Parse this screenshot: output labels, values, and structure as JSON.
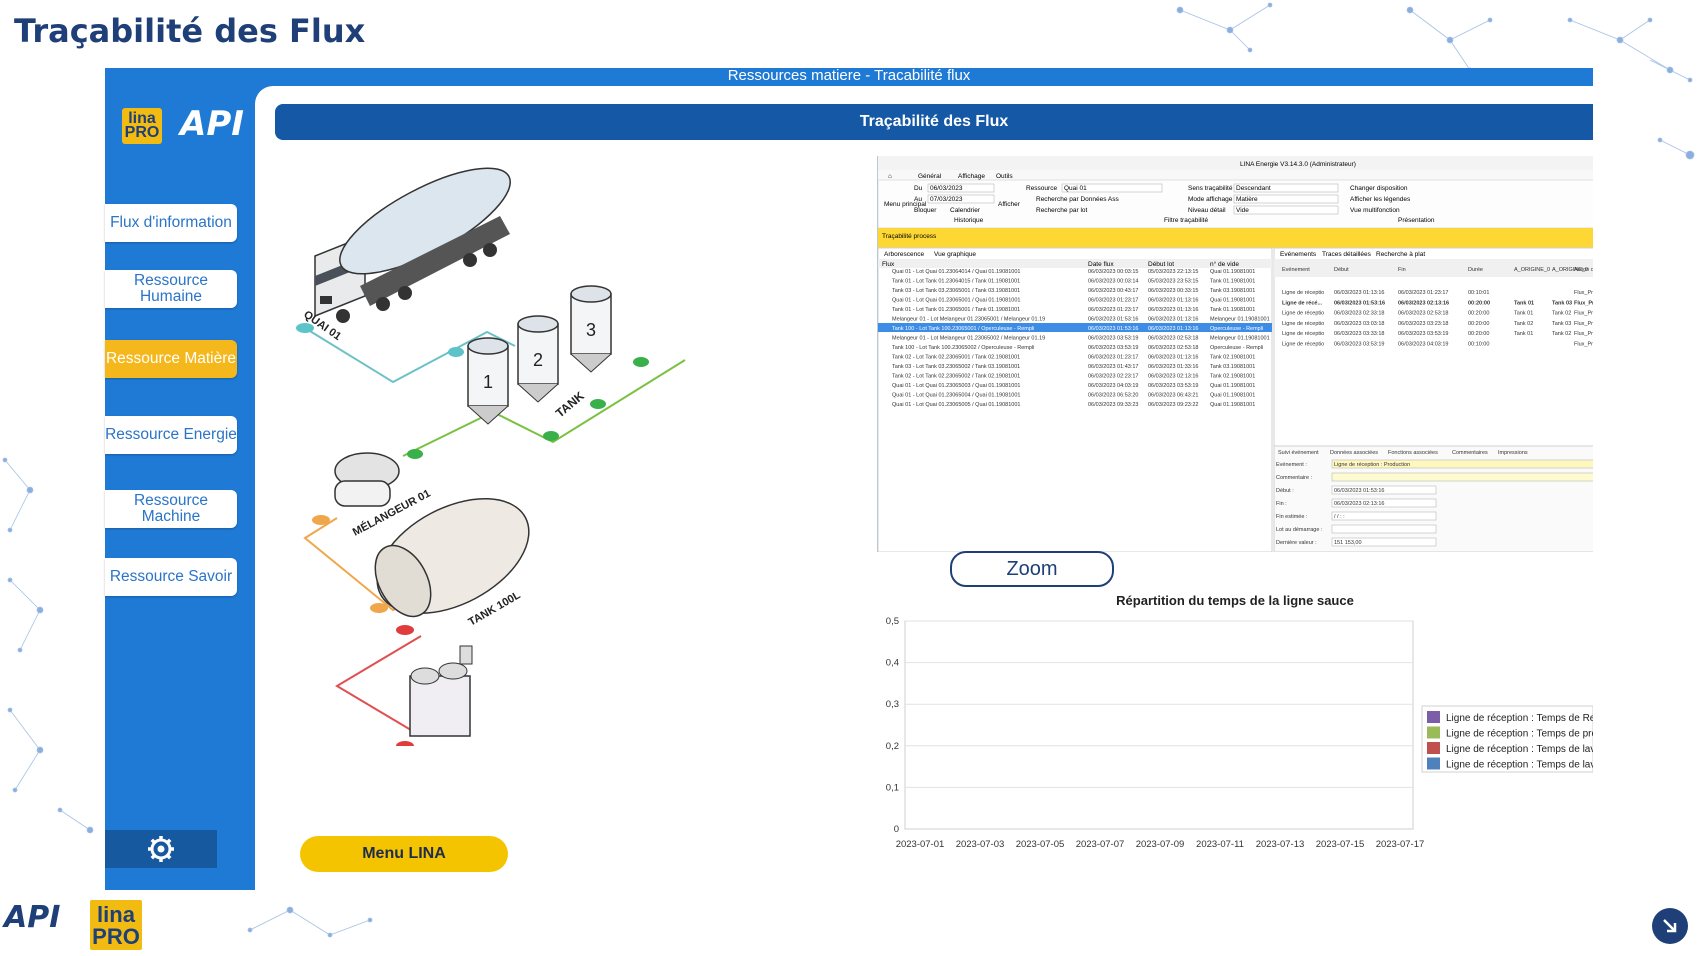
{
  "slide_title": "Traçabilité des Flux",
  "app": {
    "window_title": "Ressources matiere - Tracabilité flux",
    "logo_lina": "lina PRO",
    "logo_api": "API",
    "panel_header": "Traçabilité des Flux",
    "menu_button": "Menu LINA",
    "zoom_button": "Zoom"
  },
  "sidebar": {
    "items": [
      {
        "label": "Flux d'information",
        "active": false
      },
      {
        "label": "Ressource Humaine",
        "active": false
      },
      {
        "label": "Ressource Matière",
        "active": true
      },
      {
        "label": "Ressource Energie",
        "active": false
      },
      {
        "label": "Ressource Machine",
        "active": false
      },
      {
        "label": "Ressource Savoir",
        "active": false
      }
    ],
    "settings_icon": "gear-icon"
  },
  "diagram": {
    "labels": {
      "quai": "QUAI 01",
      "tank": "TANK",
      "tank1": "1",
      "tank2": "2",
      "tank3": "3",
      "melangeur": "MÉLANGEUR 01",
      "tank100": "TANK 100L"
    }
  },
  "embedded_app": {
    "title": "LINA Energie  V3.14.3.0  (Administrateur)",
    "tabs": [
      "Général",
      "Affichage",
      "Outils"
    ],
    "ribbon": {
      "du_label": "Du",
      "du_value": "06/03/2023",
      "au_label": "Au",
      "au_value": "07/03/2023",
      "bloquer": "Bloquer",
      "calendrier": "Calendrier",
      "historique": "Historique",
      "afficher": "Afficher",
      "ressource_label": "Ressource",
      "ressource_value": "Quai 01",
      "recherche_donnees": "Recherche par Données Ass",
      "recherche_lot": "Recherche par lot",
      "sens_label": "Sens traçabilité",
      "sens_value": "Descendant",
      "mode_label": "Mode affichage",
      "mode_value": "Matière",
      "niveau_label": "Niveau détail",
      "niveau_value": "Vide",
      "filtre": "Filtre traçabilité",
      "changer_disposition": "Changer disposition",
      "afficher_legendes": "Afficher les légendes",
      "vue_multifonction": "Vue multifonction",
      "presentation": "Présentation",
      "menu_principal": "Menu principal"
    },
    "section_title": "Traçabilité process",
    "left_tabs": [
      "Arborescence",
      "Vue graphique"
    ],
    "tree_headers": [
      "Flux",
      "Date flux",
      "Début lot",
      "n° de vide"
    ],
    "tree_rows": [
      [
        "Quai 01 - Lot Quai 01.23064014 / Quai 01.19081001",
        "06/03/2023 00:03:15",
        "05/03/2023 22:13:15",
        "Quai 01.19081001"
      ],
      [
        "Tank 01 - Lot Tank 01.23064015 / Tank 01.19081001",
        "06/03/2023 00:03:14",
        "05/03/2023 23:53:15",
        "Tank 01.19081001"
      ],
      [
        "Tank 03 - Lot Tank 03.23065001 / Tank 03.19081001",
        "06/03/2023 00:43:17",
        "06/03/2023 00:33:15",
        "Tank 03.19081001"
      ],
      [
        "Quai 01 - Lot Quai 01.23065001 / Quai 01.19081001",
        "06/03/2023 01:23:17",
        "06/03/2023 01:13:16",
        "Quai 01.19081001"
      ],
      [
        "Tank 01 - Lot Tank 01.23065001 / Tank 01.19081001",
        "06/03/2023 01:23:17",
        "06/03/2023 01:13:16",
        "Tank 01.19081001"
      ],
      [
        "Melangeur 01 - Lot Melangeur 01.23065001 / Melangeur 01.19",
        "06/03/2023 01:53:16",
        "06/03/2023 01:13:16",
        "Melangeur 01.19081001"
      ],
      [
        "Tank 100 - Lot Tank 100.23065001 / Operculeuse - Rempli",
        "06/03/2023 01:53:16",
        "06/03/2023 01:13:16",
        "Operculeuse - Rempli"
      ],
      [
        "Melangeur 01 - Lot Melangeur 01.23065002 / Melangeur 01.19",
        "06/03/2023 03:53:19",
        "06/03/2023 02:53:18",
        "Melangeur 01.19081001"
      ],
      [
        "Tank 100 - Lot Tank 100.23065002 / Operculeuse - Rempli",
        "06/03/2023 03:53:19",
        "06/03/2023 02:53:18",
        "Operculeuse - Rempli"
      ],
      [
        "Tank 02 - Lot Tank 02.23065001 / Tank 02.19081001",
        "06/03/2023 01:23:17",
        "06/03/2023 01:13:16",
        "Tank 02.19081001"
      ],
      [
        "Tank 03 - Lot Tank 03.23065002 / Tank 03.19081001",
        "06/03/2023 01:43:17",
        "06/03/2023 01:33:16",
        "Tank 03.19081001"
      ],
      [
        "Tank 02 - Lot Tank 02.23065002 / Tank 02.19081001",
        "06/03/2023 02:23:17",
        "06/03/2023 02:13:16",
        "Tank 02.19081001"
      ],
      [
        "Quai 01 - Lot Quai 01.23065003 / Quai 01.19081001",
        "06/03/2023 04:03:19",
        "06/03/2023 03:53:19",
        "Quai 01.19081001"
      ],
      [
        "Quai 01 - Lot Quai 01.23065004 / Quai 01.19081001",
        "06/03/2023 06:53:20",
        "06/03/2023 06:43:21",
        "Quai 01.19081001"
      ],
      [
        "Quai 01 - Lot Quai 01.23065005 / Quai 01.19081001",
        "06/03/2023 09:33:23",
        "06/03/2023 09:23:22",
        "Quai 01.19081001"
      ]
    ],
    "right_tabs": [
      "Evénements",
      "Traces détaillées",
      "Recherche à plat"
    ],
    "event_headers": [
      "Evénement",
      "Début",
      "Fin",
      "Durée",
      "A_ORIGINE_0",
      "A_ORIGINE_0",
      "Action de stock"
    ],
    "event_rows": [
      [
        "Ligne de réceptio",
        "06/03/2023 01:13:16",
        "06/03/2023 01:23:17",
        "00:10:01",
        "",
        "",
        "Flux_Pro"
      ],
      [
        "Ligne de récé...",
        "06/03/2023 01:53:16",
        "06/03/2023 02:13:16",
        "00:20:00",
        "Tank 01",
        "Tank 03",
        "Flux_Pro"
      ],
      [
        "Ligne de réceptio",
        "06/03/2023 02:33:18",
        "06/03/2023 02:53:18",
        "00:20:00",
        "Tank 01",
        "Tank 02",
        "Flux_Pro"
      ],
      [
        "Ligne de réceptio",
        "06/03/2023 03:03:18",
        "06/03/2023 03:23:18",
        "00:20:00",
        "Tank 02",
        "Tank 03",
        "Flux_Pro"
      ],
      [
        "Ligne de réceptio",
        "06/03/2023 03:33:18",
        "06/03/2023 03:53:19",
        "00:20:00",
        "Tank 01",
        "Tank 02",
        "Flux_Pro"
      ],
      [
        "Ligne de réceptio",
        "06/03/2023 03:53:19",
        "06/03/2023 04:03:19",
        "00:10:00",
        "",
        "",
        "Flux_Pro"
      ]
    ],
    "detail_tabs": [
      "Suivi événement",
      "Données associées",
      "Fonctions associées",
      "Commentaires",
      "Impressions"
    ],
    "detail_fields": [
      {
        "label": "Evénement :",
        "value": "Ligne de réception : Production"
      },
      {
        "label": "Commentaire :",
        "value": ""
      },
      {
        "label": "Début :",
        "value": "06/03/2023 01:53:16"
      },
      {
        "label": "Fin :",
        "value": "06/03/2023 02:13:16"
      },
      {
        "label": "Fin estimée :",
        "value": "/ /   : :"
      },
      {
        "label": "Lot au démarrage :",
        "value": ""
      },
      {
        "label": "Dernière valeur :",
        "value": "151 153,00"
      }
    ]
  },
  "chart_data": {
    "type": "bar",
    "title": "Répartition du temps de la ligne sauce",
    "categories": [
      "2023-07-01",
      "2023-07-03",
      "2023-07-05",
      "2023-07-07",
      "2023-07-09",
      "2023-07-11",
      "2023-07-13",
      "2023-07-15",
      "2023-07-17"
    ],
    "yticks": [
      "0",
      "0,1",
      "0,2",
      "0,3",
      "0,4",
      "0,5"
    ],
    "ylim": [
      0,
      0.5
    ],
    "series": [
      {
        "name": "Ligne de réception : Temps de Remplissage t",
        "color": "#7b5ea7",
        "values": [
          0,
          0,
          0,
          0,
          0,
          0,
          0,
          0,
          0
        ]
      },
      {
        "name": "Ligne de réception : Temps de production (h",
        "color": "#9bbb59",
        "values": [
          0,
          0,
          0,
          0,
          0,
          0,
          0,
          0,
          0
        ]
      },
      {
        "name": "Ligne de réception : Temps de lavage equipe",
        "color": "#c0504d",
        "values": [
          0,
          0,
          0,
          0,
          0,
          0,
          0,
          0,
          0
        ]
      },
      {
        "name": "Ligne de réception : Temps de lavage comple",
        "color": "#4f81bd",
        "values": [
          0,
          0,
          0,
          0,
          0,
          0,
          0,
          0,
          0
        ]
      }
    ],
    "legend": "right"
  }
}
